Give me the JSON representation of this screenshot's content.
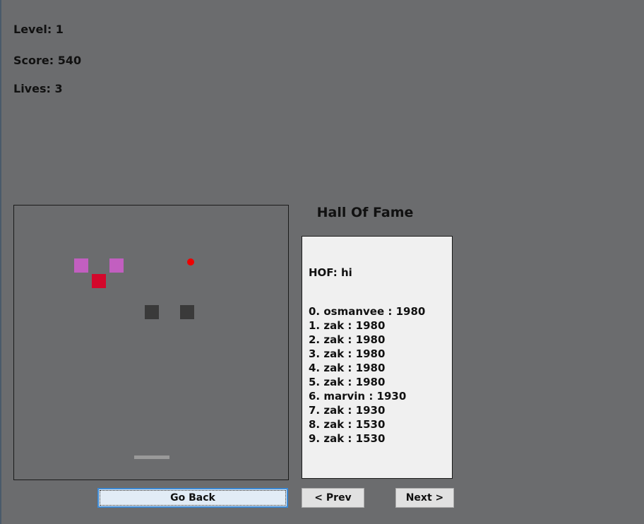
{
  "stats": {
    "level": "Level: 1",
    "score": "Score: 540",
    "lives": "Lives: 3"
  },
  "game": {
    "colors": {
      "background": "#6b6c6e",
      "brick_pink": "#c25fc0",
      "brick_red": "#d3072b",
      "brick_dark": "#3a3a3a",
      "ball": "#ee0000",
      "paddle": "#9a9a9a"
    }
  },
  "hall_of_fame": {
    "title": "Hall Of Fame",
    "header": "HOF: hi",
    "entries": [
      "0. osmanvee : 1980",
      "1. zak : 1980",
      "2. zak : 1980",
      "3. zak : 1980",
      "4. zak : 1980",
      "5. zak : 1980",
      "6. marvin : 1930",
      "7. zak : 1930",
      "8. zak : 1530",
      "9. zak : 1530"
    ]
  },
  "buttons": {
    "go_back": "Go Back",
    "prev": "< Prev",
    "next": "Next >"
  }
}
